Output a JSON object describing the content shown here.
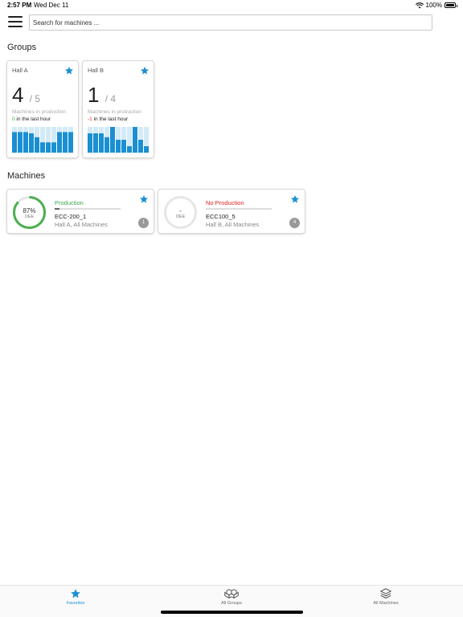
{
  "status": {
    "time": "2:57 PM",
    "date": "Wed Dec 11",
    "battery": "100%"
  },
  "search": {
    "placeholder": "Search for machines ..."
  },
  "sections": {
    "groups": "Groups",
    "machines": "Machines"
  },
  "groups": [
    {
      "name": "Hall A",
      "count": "4",
      "total": "/ 5",
      "subtitle": "Machines in production",
      "delta": "0",
      "delta_text": " in the last hour",
      "delta_color": "#3aa84a",
      "favorite": true,
      "bars": [
        0.8,
        0.8,
        0.8,
        0.75,
        0.6,
        0.4,
        0.4,
        0.4,
        0.8,
        0.8,
        0.8
      ]
    },
    {
      "name": "Hall B",
      "count": "1",
      "total": "/ 4",
      "subtitle": "Machines in production",
      "delta": "-1",
      "delta_text": " in the last hour",
      "delta_color": "#d83b2b",
      "favorite": true,
      "bars": [
        0.75,
        0.75,
        0.75,
        0.6,
        1.0,
        0.5,
        0.5,
        0.25,
        1.0,
        0.5,
        0.25
      ]
    }
  ],
  "machines": [
    {
      "state": "Production",
      "state_color": "#3aa84a",
      "oee_value": "87%",
      "oee_label": "OEE",
      "oee_fraction": 0.87,
      "progress": 0.07,
      "name": "ECC-200_1",
      "location": "Hall A, All Machines",
      "badge": "1",
      "favorite": true
    },
    {
      "state": "No Production",
      "state_color": "#e02020",
      "oee_value": "-",
      "oee_label": "OEE",
      "oee_fraction": 0,
      "progress": 0,
      "name": "ECC100_5",
      "location": "Hall B, All Machines",
      "badge": "4",
      "favorite": true
    }
  ],
  "tabs": [
    {
      "label": "Favorites",
      "icon": "star-icon",
      "active": true
    },
    {
      "label": "All Groups",
      "icon": "group-icon",
      "active": false
    },
    {
      "label": "All Machines",
      "icon": "layers-icon",
      "active": false
    }
  ],
  "colors": {
    "accent": "#1a8fd1",
    "bar": "#1a8fd1",
    "bar_bg": "#d3eaf7",
    "gauge_green": "#4caf50",
    "gauge_track": "#e6e6e6"
  }
}
